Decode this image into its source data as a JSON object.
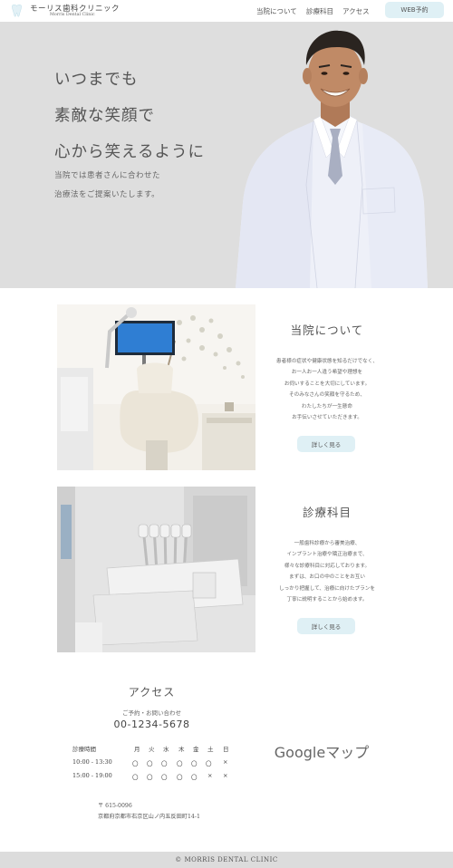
{
  "header": {
    "logo_name": "モーリス歯科クリニック",
    "logo_sub": "Morris Dental Clinic",
    "nav": [
      "当院について",
      "診療科目",
      "アクセス"
    ],
    "cta_label": "WEB予約"
  },
  "hero": {
    "title_lines": [
      "いつまでも",
      "素敵な笑顔で",
      "心から笑えるように"
    ],
    "subtitle_lines": [
      "当院では患者さんに合わせた",
      "治療法をご提案いたします。"
    ]
  },
  "about": {
    "title": "当院について",
    "text_lines": [
      "患者様の症状や健康状態を知るだけでなく、",
      "お一人お一人違う希望や理想を",
      "お伺いすることを大切にしています。",
      "そのみなさんの笑顔を守るため、",
      "わたしたちが一生懸命",
      "お手伝いさせていただきます。"
    ],
    "button_label": "詳しく見る"
  },
  "services": {
    "title": "診療科目",
    "text_lines": [
      "一般歯科診療から審美治療、",
      "インプラント治療や矯正治療まで、",
      "様々な診療科目に対応しております。",
      "まずは、お口の中のことをお互い",
      "しっかり把握して、治療に向けたプランを",
      "丁寧に説明することから始めます。"
    ],
    "button_label": "詳しく見る"
  },
  "access": {
    "title": "アクセス",
    "contact_label": "ご予約・お問い合わせ",
    "phone": "00-1234-5678",
    "hours": {
      "header_label": "診療時間",
      "days": [
        "月",
        "火",
        "水",
        "木",
        "金",
        "土",
        "日"
      ],
      "rows": [
        {
          "time": "10:00 - 13:30",
          "marks": [
            "〇",
            "〇",
            "〇",
            "〇",
            "〇",
            "〇",
            "×"
          ]
        },
        {
          "time": "15:00 - 19:00",
          "marks": [
            "〇",
            "〇",
            "〇",
            "〇",
            "〇",
            "×",
            "×"
          ]
        }
      ]
    },
    "postal": "〒 615-0096",
    "address": "京都府京都市右京区山ノ内五反田町14-1",
    "map_label": "Googleマップ"
  },
  "footer": {
    "copyright": "© MORRIS DENTAL CLINIC"
  },
  "colors": {
    "accent_button": "#dff0f5",
    "hero_bg": "#dedede",
    "footer_bg": "#dcdcdc"
  }
}
